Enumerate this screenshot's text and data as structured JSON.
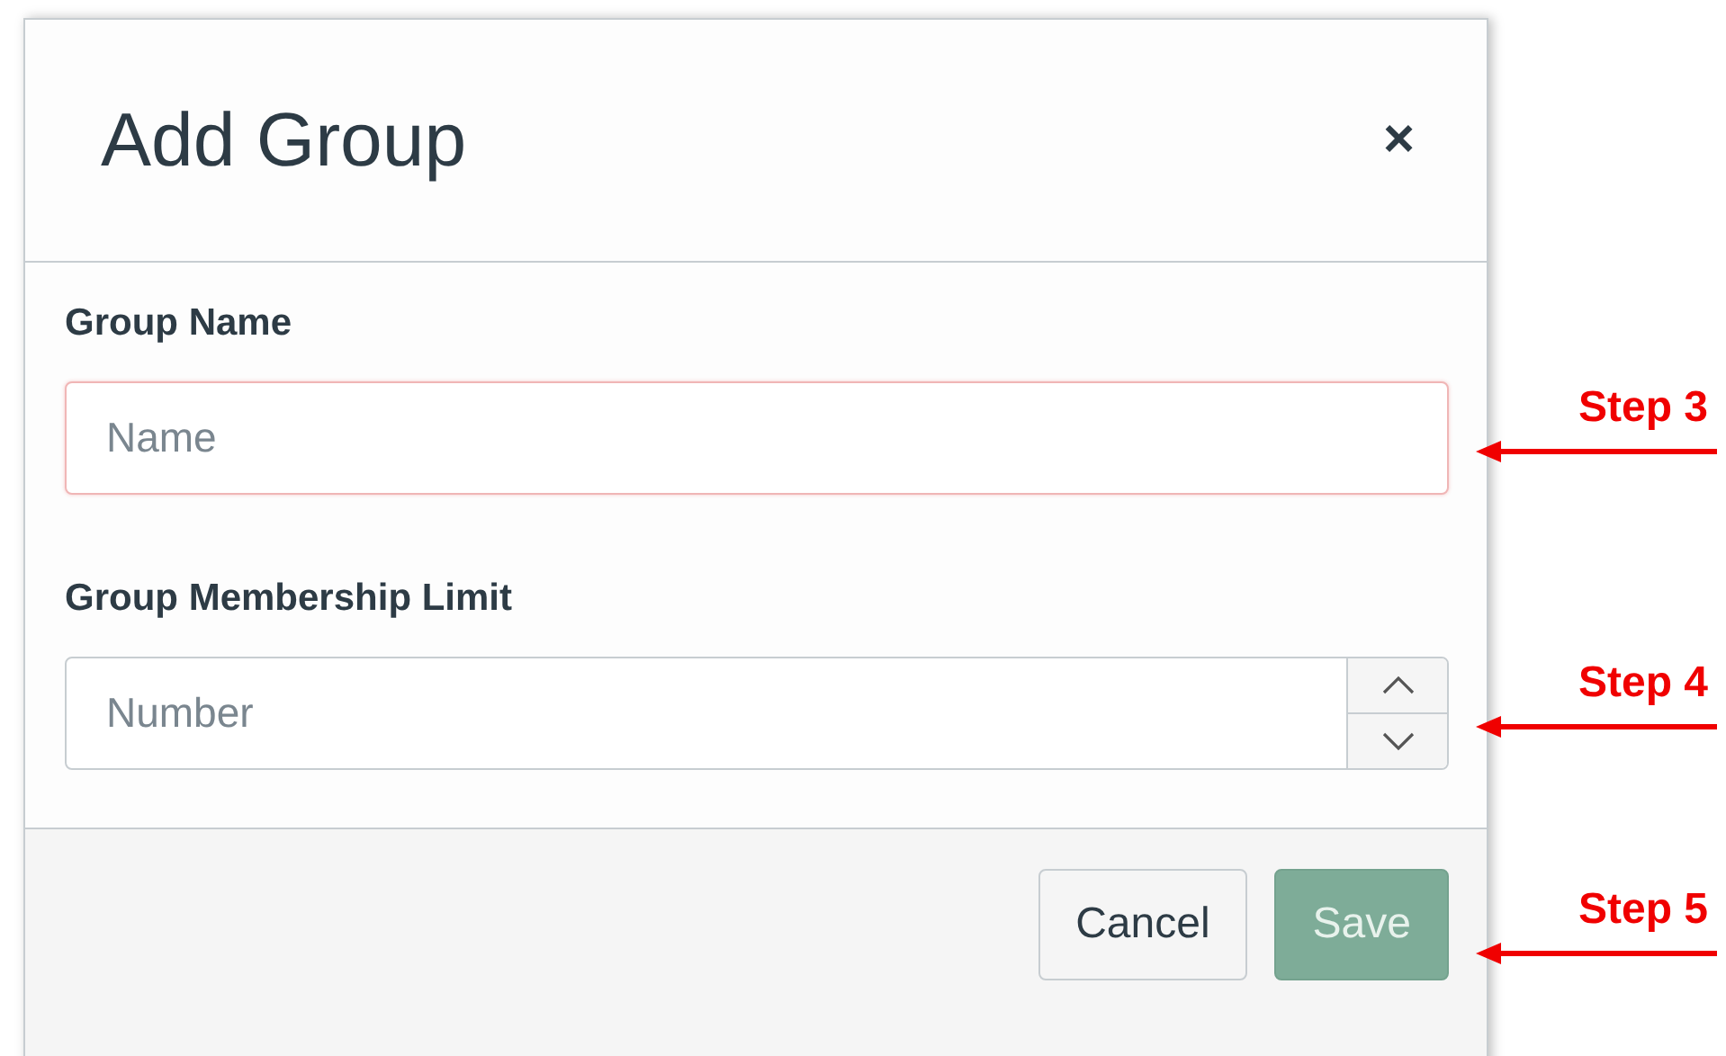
{
  "dialog": {
    "title": "Add Group",
    "close": "×",
    "fields": [
      {
        "label": "Group Name",
        "placeholder": "Name",
        "kind": "text",
        "invalid": true,
        "annotation": "Step 3"
      },
      {
        "label": "Group Membership Limit",
        "placeholder": "Number",
        "kind": "number",
        "invalid": false,
        "annotation": "Step 4"
      }
    ],
    "buttons": [
      {
        "label": "Cancel",
        "kind": "secondary",
        "disabled": false
      },
      {
        "label": "Save",
        "kind": "primary",
        "disabled": true
      }
    ],
    "footer_annotation": "Step 5"
  }
}
